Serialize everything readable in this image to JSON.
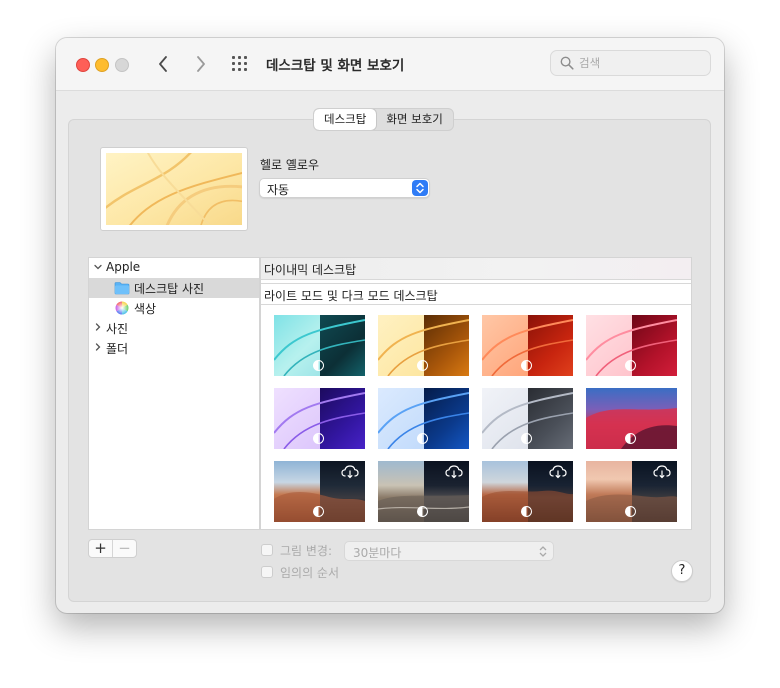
{
  "window": {
    "title": "데스크탑 및 화면 보호기",
    "search_placeholder": "검색"
  },
  "tabs": [
    {
      "label": "데스크탑",
      "active": true
    },
    {
      "label": "화면 보호기",
      "active": false
    }
  ],
  "current_wallpaper": {
    "name": "헬로 옐로우",
    "mode": "자동"
  },
  "sidebar": {
    "items": [
      {
        "label": "Apple",
        "expanded": true,
        "level": 0
      },
      {
        "label": "데스크탑 사진",
        "icon": "folder-icon",
        "selected": true,
        "level": 1
      },
      {
        "label": "색상",
        "icon": "color-wheel-icon",
        "selected": false,
        "level": 1
      },
      {
        "label": "사진",
        "expanded": false,
        "level": 0
      },
      {
        "label": "폴더",
        "expanded": false,
        "level": 0
      }
    ],
    "add_label": "+",
    "remove_label": "−"
  },
  "sections": {
    "dynamic": "다이내믹 데스크탑",
    "light_dark": "라이트 모드 및 다크 모드 데스크탑"
  },
  "thumbnails": [
    {
      "name": "teal",
      "download": false
    },
    {
      "name": "yellow",
      "download": false
    },
    {
      "name": "orange",
      "download": false
    },
    {
      "name": "pink",
      "download": false
    },
    {
      "name": "purple",
      "download": false
    },
    {
      "name": "blue",
      "download": false
    },
    {
      "name": "silver",
      "download": false
    },
    {
      "name": "big-sur",
      "download": false
    },
    {
      "name": "coast-rocks-1",
      "download": true
    },
    {
      "name": "coast-rocks-2",
      "download": true
    },
    {
      "name": "coast-rocks-3",
      "download": true
    },
    {
      "name": "coast-rocks-4",
      "download": true
    }
  ],
  "options": {
    "change_picture_label": "그림 변경:",
    "interval_value": "30분마다",
    "random_order_label": "임의의 순서"
  },
  "help_label": "?",
  "colors": {
    "accent": "#2f7cf6",
    "close": "#fe5f57",
    "minimize": "#febc2e"
  }
}
